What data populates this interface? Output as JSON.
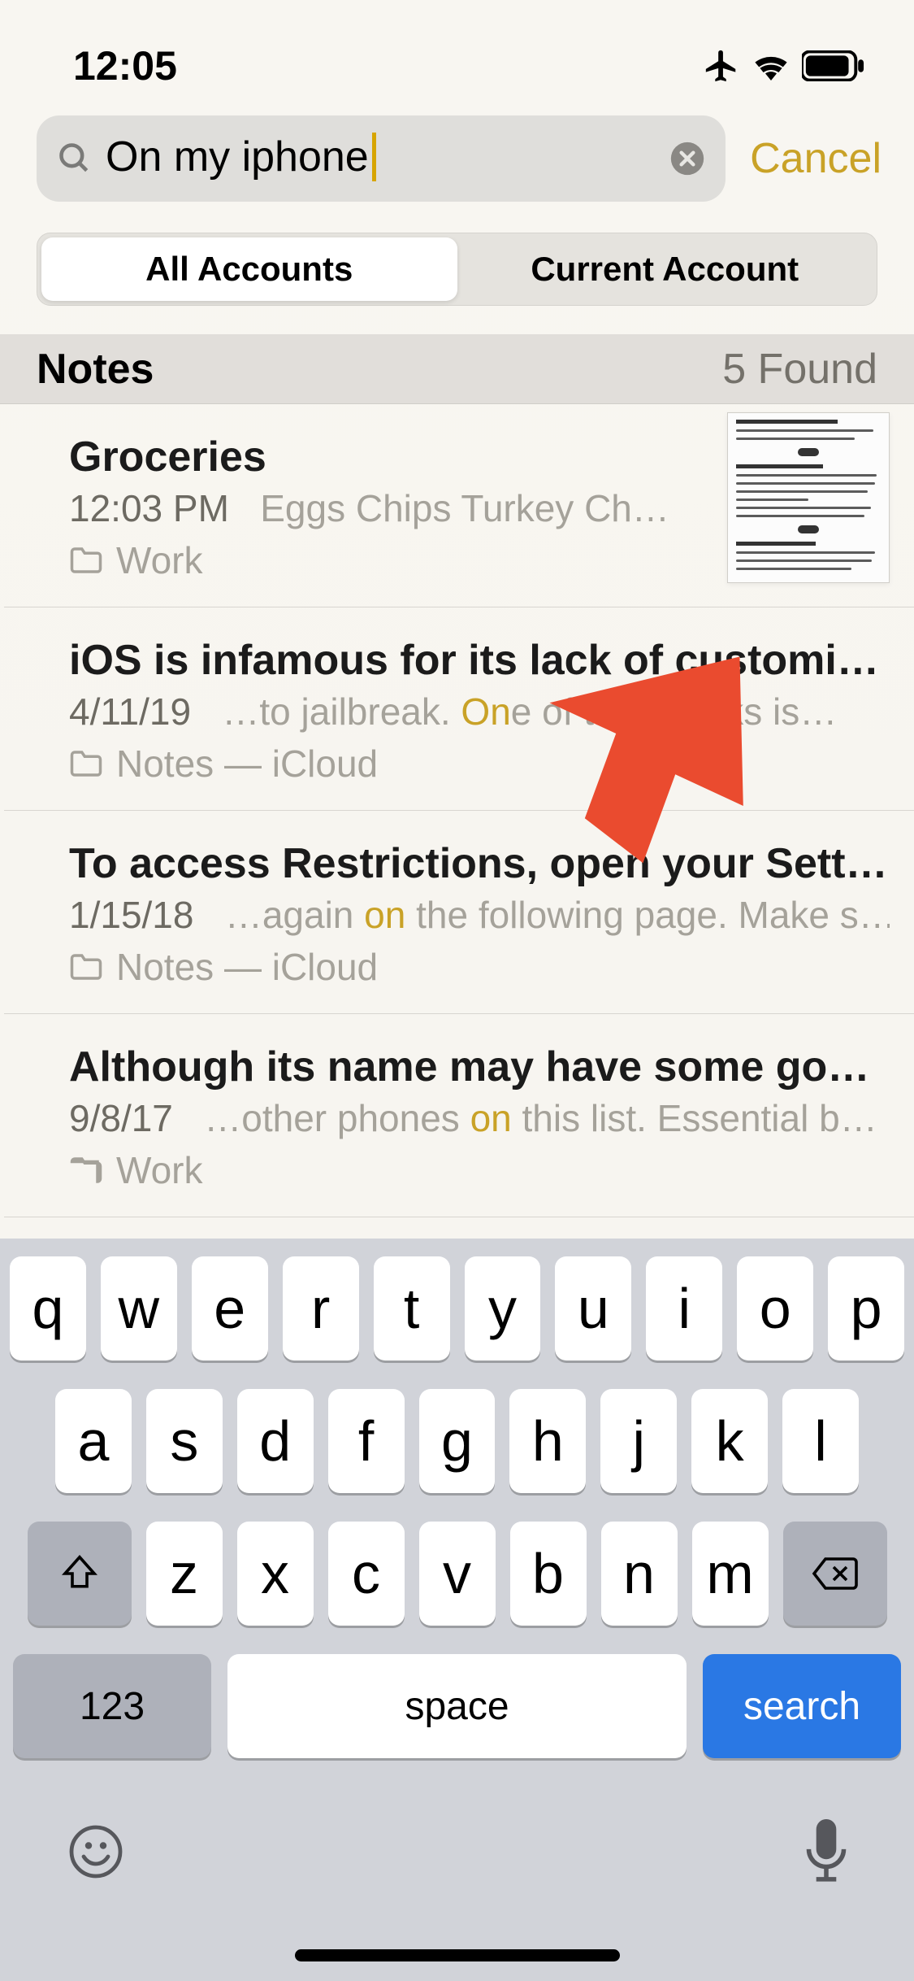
{
  "status": {
    "time": "12:05"
  },
  "search": {
    "value": "On my iphone",
    "cancel": "Cancel"
  },
  "segments": {
    "all": "All Accounts",
    "current": "Current Account"
  },
  "section": {
    "title": "Notes",
    "count": "5 Found"
  },
  "notes": [
    {
      "title": "Groceries",
      "date": "12:03 PM",
      "preview_pre": "",
      "preview_hl": "",
      "preview_post": "Eggs Chips Turkey Ch…",
      "folder": "Work",
      "has_thumb": true
    },
    {
      "title": "iOS is infamous for its lack of customiz…",
      "date": "4/11/19",
      "preview_pre": "…to jailbreak. ",
      "preview_hl": "On",
      "preview_post": "e of the tweaks is…",
      "folder": "Notes — iCloud"
    },
    {
      "title": "To access Restrictions, open your Setti…",
      "date": "1/15/18",
      "preview_pre": "…again ",
      "preview_hl": "on",
      "preview_post": " the following page. Make s…",
      "folder": "Notes — iCloud"
    },
    {
      "title": "Although its name may have some goof…",
      "date": "9/8/17",
      "preview_pre": "…other phones ",
      "preview_hl": "on",
      "preview_post": " this list. Essential b…",
      "folder": "Work"
    }
  ],
  "keyboard": {
    "row1": [
      "q",
      "w",
      "e",
      "r",
      "t",
      "y",
      "u",
      "i",
      "o",
      "p"
    ],
    "row2": [
      "a",
      "s",
      "d",
      "f",
      "g",
      "h",
      "j",
      "k",
      "l"
    ],
    "row3": [
      "z",
      "x",
      "c",
      "v",
      "b",
      "n",
      "m"
    ],
    "numkey": "123",
    "space": "space",
    "search": "search"
  }
}
